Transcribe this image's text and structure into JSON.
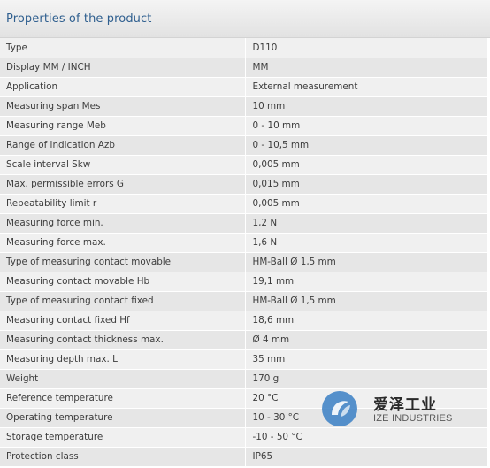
{
  "header": {
    "title": "Properties of the product"
  },
  "rows": [
    {
      "label": "Type",
      "value": "D110"
    },
    {
      "label": "Display MM / INCH",
      "value": "MM"
    },
    {
      "label": "Application",
      "value": "External measurement"
    },
    {
      "label": "Measuring span Mes",
      "value": "10 mm"
    },
    {
      "label": "Measuring range Meb",
      "value": "0 - 10 mm"
    },
    {
      "label": "Range of indication Azb",
      "value": "0 - 10,5 mm"
    },
    {
      "label": "Scale interval Skw",
      "value": "0,005 mm"
    },
    {
      "label": "Max. permissible errors G",
      "value": "0,015 mm"
    },
    {
      "label": "Repeatability limit r",
      "value": "0,005 mm"
    },
    {
      "label": "Measuring force min.",
      "value": "1,2 N"
    },
    {
      "label": "Measuring force max.",
      "value": "1,6 N"
    },
    {
      "label": "Type of measuring contact movable",
      "value": "HM-Ball Ø 1,5 mm"
    },
    {
      "label": "Measuring contact movable Hb",
      "value": "19,1 mm"
    },
    {
      "label": "Type of measuring contact fixed",
      "value": "HM-Ball Ø 1,5 mm"
    },
    {
      "label": "Measuring contact fixed Hf",
      "value": "18,6 mm"
    },
    {
      "label": "Measuring contact thickness max.",
      "value": "Ø 4 mm"
    },
    {
      "label": "Measuring depth max. L",
      "value": "35 mm"
    },
    {
      "label": "Weight",
      "value": "170 g"
    },
    {
      "label": "Reference temperature",
      "value": "20 °C"
    },
    {
      "label": "Operating temperature",
      "value": "10 - 30 °C"
    },
    {
      "label": "Storage temperature",
      "value": "-10 - 50 °C"
    },
    {
      "label": "Protection class",
      "value": "IP65"
    }
  ],
  "watermark": {
    "chinese": "爱泽工业",
    "english": "IZE INDUSTRIES",
    "logo_icon": "ize-logo-icon",
    "logo_color": "#3a7fc4"
  },
  "colors": {
    "header_title": "#2f5f8f",
    "row_odd": "#f0f0f0",
    "row_even": "#e6e6e6",
    "text": "#3c3c3c"
  }
}
